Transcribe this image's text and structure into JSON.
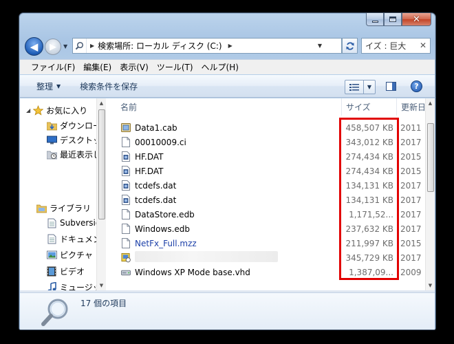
{
  "window": {
    "address_label": "検索場所: ローカル ディスク (C:)",
    "search_placeholder": "イズ : 巨大",
    "menu": [
      "ファイル(F)",
      "編集(E)",
      "表示(V)",
      "ツール(T)",
      "ヘルプ(H)"
    ],
    "commands": {
      "organize": "整理",
      "save_search": "検索条件を保存"
    }
  },
  "nav": {
    "items": [
      {
        "label": "お気に入り",
        "icon": "star-icon"
      },
      {
        "label": "ダウンロード",
        "icon": "download-folder-icon"
      },
      {
        "label": "デスクトップ",
        "icon": "desktop-icon"
      },
      {
        "label": "最近表示した場所",
        "icon": "recent-places-icon"
      },
      {
        "label": "ライブラリ",
        "icon": "library-icon"
      },
      {
        "label": "Subversion",
        "icon": "document-library-icon"
      },
      {
        "label": "ドキュメント",
        "icon": "document-library-icon"
      },
      {
        "label": "ピクチャ",
        "icon": "pictures-icon"
      },
      {
        "label": "ビデオ",
        "icon": "video-icon"
      },
      {
        "label": "ミュージック",
        "icon": "music-icon"
      }
    ]
  },
  "columns": {
    "name": "名前",
    "size": "サイズ",
    "date": "更新日"
  },
  "files": [
    {
      "name": "Data1.cab",
      "size": "458,507 KB",
      "date": "2011",
      "icon": "cab-archive-icon"
    },
    {
      "name": "00010009.ci",
      "size": "343,012 KB",
      "date": "2017",
      "icon": "blank-file-icon"
    },
    {
      "name": "HF.DAT",
      "size": "274,434 KB",
      "date": "2015",
      "icon": "system-file-icon"
    },
    {
      "name": "HF.DAT",
      "size": "274,434 KB",
      "date": "2015",
      "icon": "system-file-icon"
    },
    {
      "name": "tcdefs.dat",
      "size": "134,131 KB",
      "date": "2017",
      "icon": "system-file-icon"
    },
    {
      "name": "tcdefs.dat",
      "size": "134,131 KB",
      "date": "2017",
      "icon": "system-file-icon"
    },
    {
      "name": "DataStore.edb",
      "size": "1,171,52...",
      "date": "2017",
      "icon": "blank-file-icon"
    },
    {
      "name": "Windows.edb",
      "size": "237,632 KB",
      "date": "2017",
      "icon": "blank-file-icon"
    },
    {
      "name": "NetFx_Full.mzz",
      "size": "211,997 KB",
      "date": "2015",
      "icon": "blank-file-icon",
      "link": true
    },
    {
      "name": "",
      "size": "345,729 KB",
      "date": "2017",
      "icon": "installer-icon",
      "redacted": true
    },
    {
      "name": "Windows XP Mode base.vhd",
      "size": "1,387,09...",
      "date": "2009",
      "icon": "vhd-drive-icon"
    }
  ],
  "status": {
    "count_text": "17 個の項目"
  },
  "colors": {
    "highlight": "#e10000",
    "link": "#1b3fa8"
  }
}
